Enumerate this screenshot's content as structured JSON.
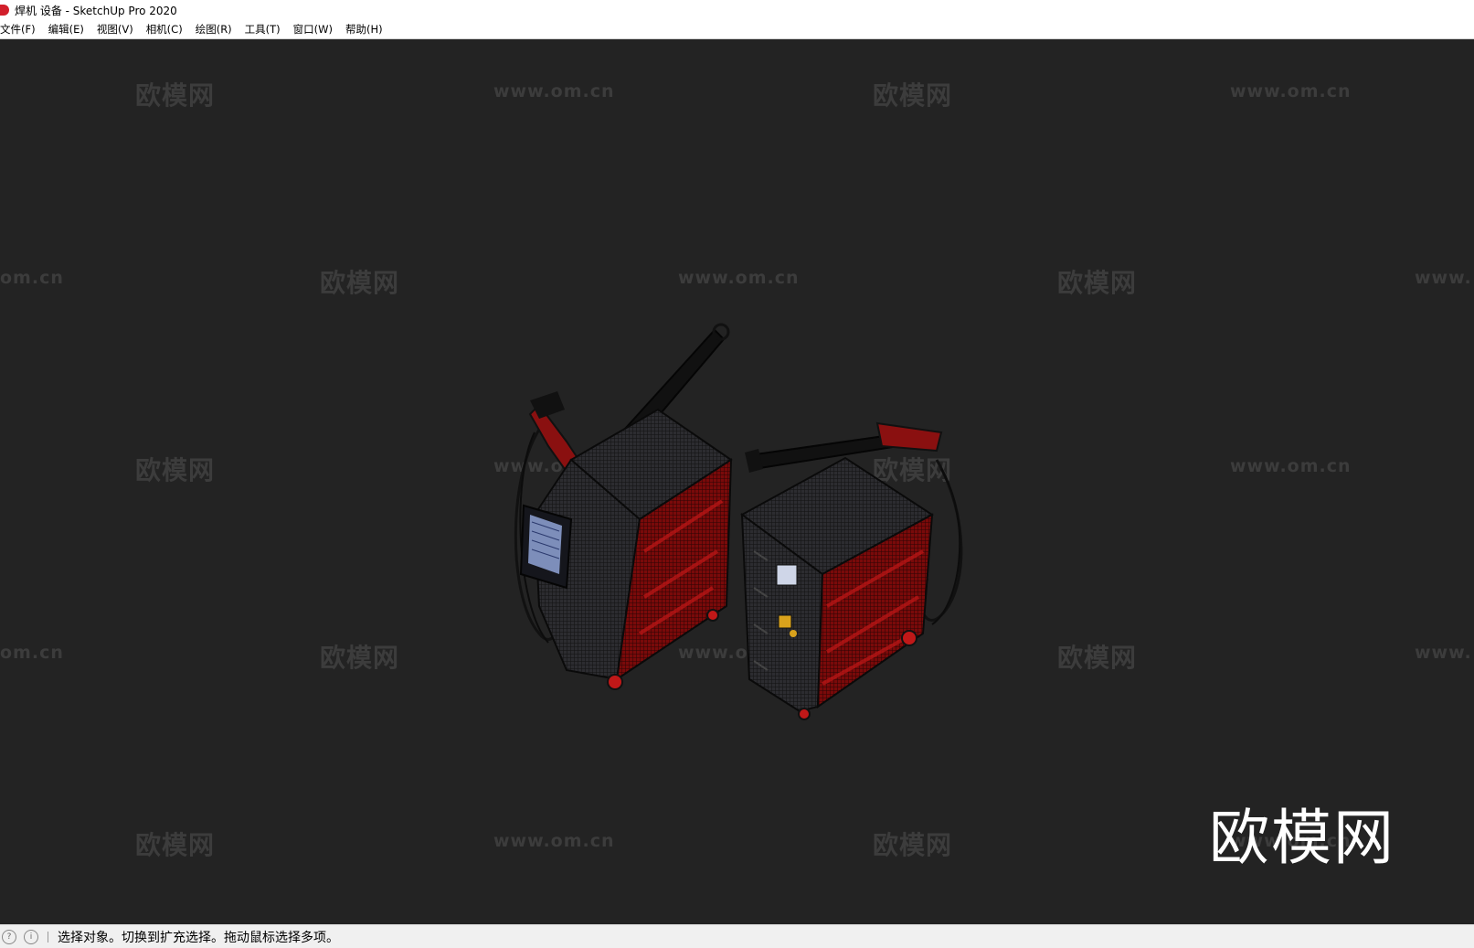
{
  "window": {
    "title": "焊机 设备 - SketchUp Pro 2020"
  },
  "menu": {
    "items": [
      "文件(F)",
      "编辑(E)",
      "视图(V)",
      "相机(C)",
      "绘图(R)",
      "工具(T)",
      "窗口(W)",
      "帮助(H)"
    ]
  },
  "watermark": {
    "brand": "欧模网",
    "url": "www.om.cn",
    "url_cropped_left": "om.cn",
    "url_cropped_right": "www."
  },
  "status": {
    "message": "选择对象。切换到扩充选择。拖动鼠标选择多项。"
  },
  "colors": {
    "viewport_bg": "#232323",
    "model_red": "#b01414",
    "watermark": "#3c3c3c"
  }
}
